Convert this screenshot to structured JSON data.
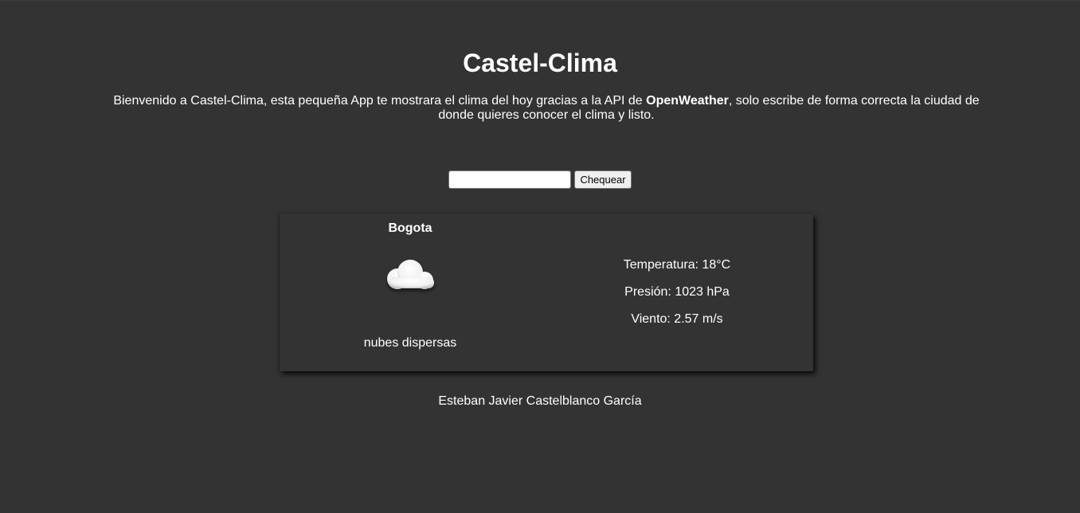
{
  "header": {
    "title": "Castel-Clima",
    "intro_before": "Bienvenido a Castel-Clima, esta pequeña App te mostrara el clima del hoy gracias a la API de ",
    "intro_brand": "OpenWeather",
    "intro_after": ", solo escribe de forma correcta la ciudad de donde quieres conocer el clima y listo."
  },
  "search": {
    "value": "",
    "placeholder": "",
    "button_label": "Chequear"
  },
  "weather": {
    "city": "Bogota",
    "icon": "cloud-icon",
    "description": "nubes dispersas",
    "temperature": "Temperatura: 18°C",
    "pressure": "Presión: 1023 hPa",
    "wind": "Viento: 2.57 m/s"
  },
  "footer": {
    "author": "Esteban Javier Castelblanco García"
  },
  "colors": {
    "background": "#333333",
    "text": "#ffffff"
  }
}
